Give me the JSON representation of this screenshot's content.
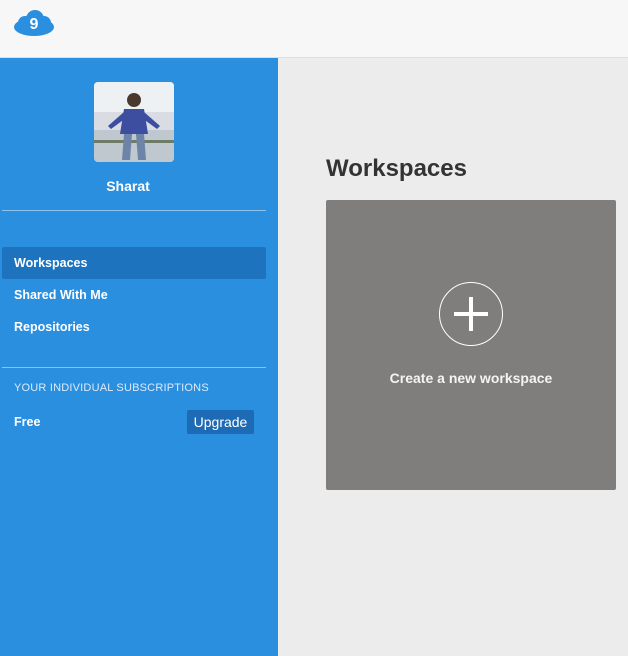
{
  "header": {
    "logo_icon": "cloud9-logo-icon",
    "logo_number": "9"
  },
  "sidebar": {
    "user": {
      "name": "Sharat",
      "avatar_icon": "avatar-photo"
    },
    "nav": [
      {
        "label": "Workspaces",
        "active": true
      },
      {
        "label": "Shared With Me",
        "active": false
      },
      {
        "label": "Repositories",
        "active": false
      }
    ],
    "subscriptions": {
      "heading": "YOUR INDIVIDUAL SUBSCRIPTIONS",
      "plan": "Free",
      "upgrade_label": "Upgrade"
    }
  },
  "main": {
    "title": "Workspaces",
    "create_card": {
      "label": "Create a new workspace",
      "icon": "plus-icon"
    }
  },
  "colors": {
    "sidebar_bg": "#2b8fe0",
    "active_item_bg": "#1e73bf",
    "card_bg": "#807e7c",
    "page_bg": "#ececec"
  }
}
